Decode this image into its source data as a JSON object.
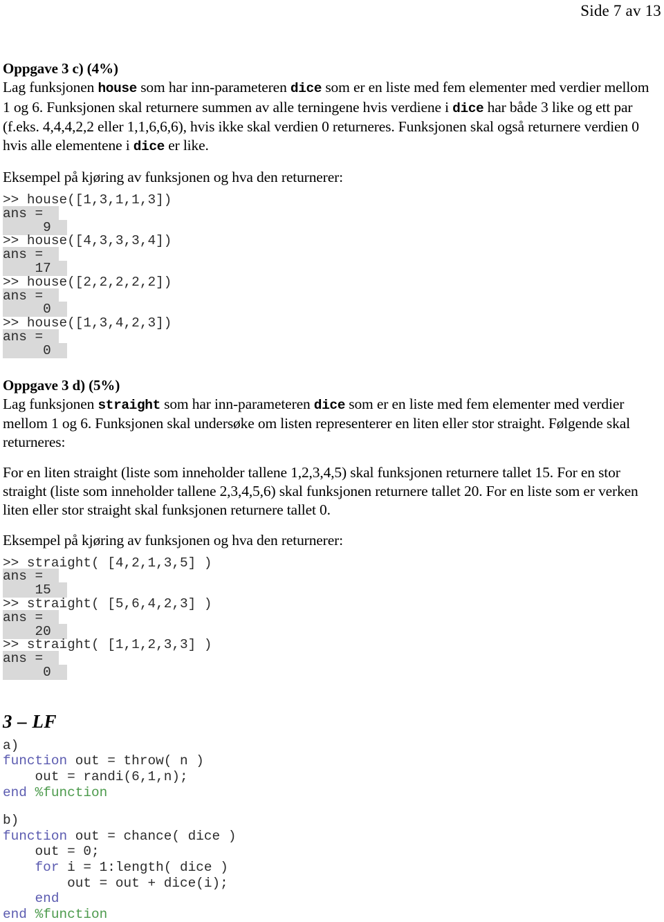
{
  "header": {
    "page_label": "Side 7 av 13"
  },
  "task_c": {
    "heading": "Oppgave 3 c) (4%)",
    "paragraph_parts": [
      {
        "t": "Lag funksjonen ",
        "code": false
      },
      {
        "t": "house",
        "code": true
      },
      {
        "t": " som har inn-parameteren ",
        "code": false
      },
      {
        "t": "dice",
        "code": true
      },
      {
        "t": " som er en liste med fem elementer med verdier mellom 1 og 6. Funksjonen skal returnere summen av alle terningene hvis verdiene i ",
        "code": false
      },
      {
        "t": "dice",
        "code": true
      },
      {
        "t": " har både 3 like og ett par (f.eks. 4,4,4,2,2 eller 1,1,6,6,6), hvis ikke skal verdien 0 returneres. Funksjonen skal også returnere verdien 0 hvis alle elementene i ",
        "code": false
      },
      {
        "t": "dice",
        "code": true
      },
      {
        "t": " er like.",
        "code": false
      }
    ],
    "example_intro": "Eksempel på kjøring av funksjonen og hva den returnerer:",
    "console": [
      {
        "kind": "prompt",
        "text": ">> house([1,3,1,1,3])"
      },
      {
        "kind": "ans",
        "text": "ans ="
      },
      {
        "kind": "value",
        "text": "     9"
      },
      {
        "kind": "prompt",
        "text": ">> house([4,3,3,3,4])"
      },
      {
        "kind": "ans",
        "text": "ans ="
      },
      {
        "kind": "value",
        "text": "    17"
      },
      {
        "kind": "prompt",
        "text": ">> house([2,2,2,2,2])"
      },
      {
        "kind": "ans",
        "text": "ans ="
      },
      {
        "kind": "value",
        "text": "     0"
      },
      {
        "kind": "prompt",
        "text": ">> house([1,3,4,2,3])"
      },
      {
        "kind": "ans",
        "text": "ans ="
      },
      {
        "kind": "value",
        "text": "     0"
      }
    ]
  },
  "task_d": {
    "heading": "Oppgave 3 d) (5%)",
    "paragraph_parts": [
      {
        "t": "Lag funksjonen ",
        "code": false
      },
      {
        "t": "straight",
        "code": true
      },
      {
        "t": " som har inn-parameteren ",
        "code": false
      },
      {
        "t": "dice",
        "code": true
      },
      {
        "t": " som er en liste med fem elementer med verdier mellom 1 og 6. Funksjonen skal undersøke om listen representerer en liten eller stor straight. Følgende skal returneres:",
        "code": false
      }
    ],
    "rules_paragraph": "For en liten straight (liste som inneholder tallene 1,2,3,4,5) skal funksjonen returnere tallet 15. For en stor straight (liste som inneholder tallene 2,3,4,5,6) skal funksjonen returnere tallet 20. For en liste som er verken liten eller stor straight skal funksjonen returnere tallet 0.",
    "example_intro": "Eksempel på kjøring av funksjonen og hva den returnerer:",
    "console": [
      {
        "kind": "prompt",
        "text": ">> straight( [4,2,1,3,5] )"
      },
      {
        "kind": "ans",
        "text": "ans ="
      },
      {
        "kind": "value",
        "text": "    15"
      },
      {
        "kind": "prompt",
        "text": ">> straight( [5,6,4,2,3] )"
      },
      {
        "kind": "ans",
        "text": "ans ="
      },
      {
        "kind": "value",
        "text": "    20"
      },
      {
        "kind": "prompt",
        "text": ">> straight( [1,1,2,3,3] )"
      },
      {
        "kind": "ans",
        "text": "ans ="
      },
      {
        "kind": "value",
        "text": "     0"
      }
    ]
  },
  "solutions": {
    "heading": "3 – LF",
    "part_a": {
      "label": "a)",
      "lines": [
        [
          {
            "t": "function",
            "c": "kw"
          },
          {
            "t": " out = throw( n )",
            "c": "plain"
          }
        ],
        [
          {
            "t": "    out = randi(6,1,n);",
            "c": "plain"
          }
        ],
        [
          {
            "t": "end",
            "c": "kw"
          },
          {
            "t": " ",
            "c": "plain"
          },
          {
            "t": "%function",
            "c": "cmt"
          }
        ]
      ]
    },
    "part_b": {
      "label": "b)",
      "lines": [
        [
          {
            "t": "function",
            "c": "kw"
          },
          {
            "t": " out = chance( dice )",
            "c": "plain"
          }
        ],
        [
          {
            "t": "    out = 0;",
            "c": "plain"
          }
        ],
        [
          {
            "t": "    ",
            "c": "plain"
          },
          {
            "t": "for",
            "c": "kw"
          },
          {
            "t": " i = 1:length( dice )",
            "c": "plain"
          }
        ],
        [
          {
            "t": "        out = out + dice(i);",
            "c": "plain"
          }
        ],
        [
          {
            "t": "    ",
            "c": "plain"
          },
          {
            "t": "end",
            "c": "kw"
          }
        ],
        [
          {
            "t": "end",
            "c": "kw"
          },
          {
            "t": " ",
            "c": "plain"
          },
          {
            "t": "%function",
            "c": "cmt"
          }
        ]
      ]
    }
  },
  "colors": {
    "keyword": "#5b5bb0",
    "comment": "#4c9a4c",
    "console_text": "#2b2b2b",
    "console_highlight": "#d9d9d9",
    "page_background": "#ffffff"
  }
}
